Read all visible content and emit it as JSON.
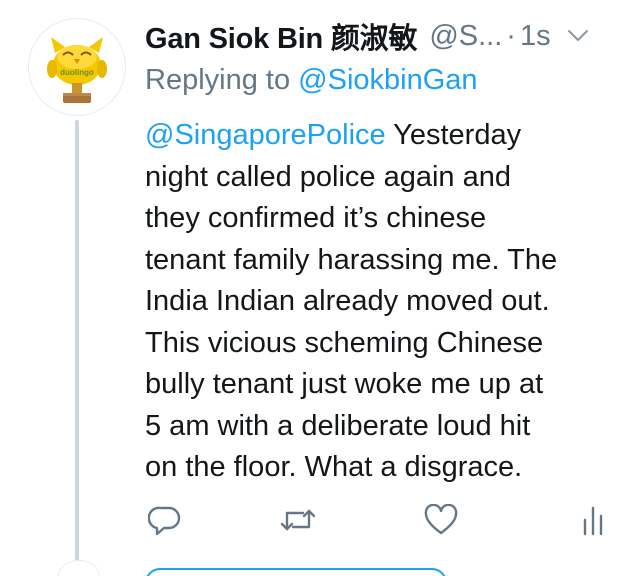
{
  "tweet": {
    "author_name": "Gan Siok Bin 颜淑敏",
    "handle": "@S...",
    "dot": "·",
    "time": "1s",
    "reply_prefix": "Replying to",
    "reply_to": "@SiokbinGan",
    "avatar_text": "duolingo",
    "body": {
      "mention": "@SingaporePolice",
      "line1_rest": " Yesterday",
      "line2": "night called police again and",
      "line3": "they confirmed it’s chinese",
      "line4": "tenant family harassing me. The",
      "line5": "India Indian already moved out.",
      "line6": "This vicious scheming Chinese",
      "line7": "bully tenant just woke me up at",
      "line8": "5 am with a deliberate loud hit",
      "line9": "on the floor. What a disgrace."
    }
  },
  "icons": {
    "more": "chevron-down-icon",
    "reply": "reply-icon",
    "retweet": "retweet-icon",
    "like": "heart-icon",
    "analytics": "analytics-icon"
  },
  "colors": {
    "accent": "#1da1f2",
    "secondary_text": "#657786",
    "primary_text": "#14171a",
    "thread_line": "#ccd6dd",
    "owl_green": "#8ac43f",
    "owl_yellow": "#f5c700",
    "trophy_brown": "#a8743a"
  }
}
